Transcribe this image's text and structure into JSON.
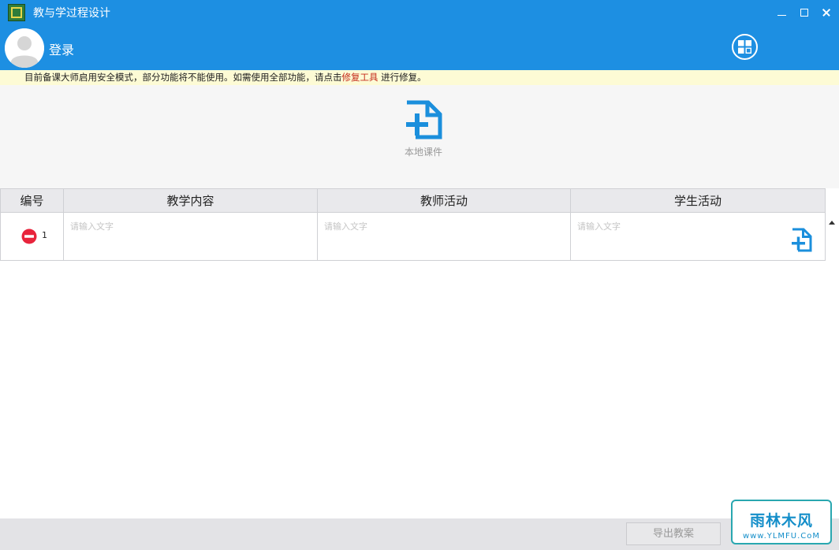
{
  "window": {
    "title": "教与学过程设计",
    "icon": "app-logo-icon",
    "controls": [
      "minimize-icon",
      "maximize-icon",
      "close-icon"
    ]
  },
  "header": {
    "login_label": "登录",
    "avatar_icon": "user-avatar-icon",
    "apps_icon": "grid-apps-icon",
    "background_color": "#1d8fe2"
  },
  "notice": {
    "text_before": "目前备课大师启用安全模式，部分功能将不能使用。如需使用全部功能，请点击",
    "link_text": "修复工具",
    "text_after": " 进行修复。",
    "link_color": "#c42b1c"
  },
  "toolbar": {
    "local_courseware_label": "本地课件",
    "local_courseware_icon": "add-file-icon",
    "accent_color": "#1b8fdc"
  },
  "table": {
    "columns": [
      "编号",
      "教学内容",
      "教师活动",
      "学生活动"
    ],
    "rows": [
      {
        "number": "1",
        "delete_icon": "remove-circle-icon",
        "content_placeholder": "请输入文字",
        "teacher_placeholder": "请输入文字",
        "student_placeholder": "请输入文字",
        "add_icon": "add-file-icon"
      }
    ]
  },
  "footer": {
    "export_label": "导出教案"
  },
  "watermark": {
    "title": "雨林木风",
    "url": "www.YLMFU.CoM"
  }
}
